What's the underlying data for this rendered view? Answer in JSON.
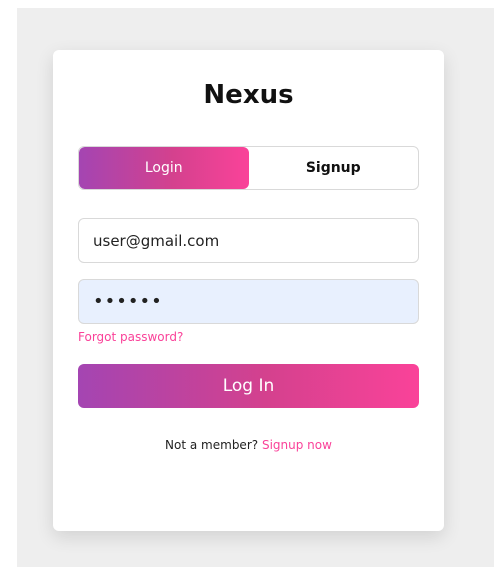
{
  "app": {
    "title": "Nexus"
  },
  "tabs": [
    {
      "label": "Login",
      "active": true
    },
    {
      "label": "Signup",
      "active": false
    }
  ],
  "form": {
    "email_value": "user@gmail.com",
    "password_value": "••••••",
    "forgot_label": "Forgot password?",
    "submit_label": "Log In"
  },
  "footer": {
    "prompt": "Not a member?",
    "signup_link": "Signup now"
  },
  "colors": {
    "accent_start": "#a445b2",
    "accent_end": "#fa4299",
    "link": "#fa4299",
    "password_bg": "#e8f0fe",
    "backdrop": "#eeeeee"
  }
}
